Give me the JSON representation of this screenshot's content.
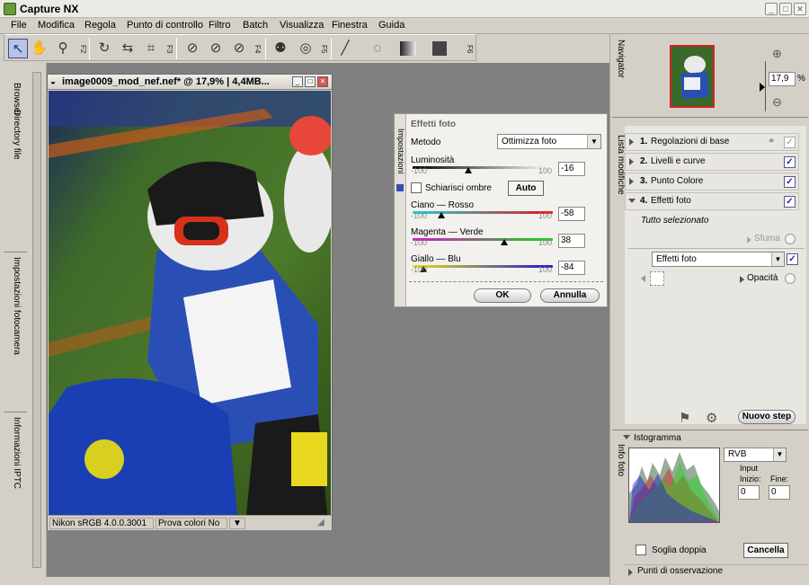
{
  "app": {
    "title": "Capture NX"
  },
  "window_controls": {
    "minimize": "_",
    "maximize": "□",
    "close": "✕"
  },
  "menu": [
    "File",
    "Modifica",
    "Regola",
    "Punto di controllo",
    "Filtro",
    "Batch",
    "Visualizza",
    "Finestra",
    "Guida"
  ],
  "toolbar": {
    "fkeys": [
      "F2",
      "F3",
      "F4",
      "F5",
      "F6"
    ],
    "icons": [
      "arrow-select-icon",
      "hand-icon",
      "zoom-icon",
      "rotate-icon",
      "straighten-icon",
      "crop-icon",
      "black-point-icon",
      "neutral-point-icon",
      "white-point-icon",
      "red-eye-icon",
      "selection-control-point-icon",
      "brush-icon",
      "lasso-icon",
      "gradient-icon",
      "fill-icon"
    ]
  },
  "left_tabs": [
    "Browser",
    "Directory file",
    "Impostazioni fotocamera",
    "Informazioni IPTC"
  ],
  "image_window": {
    "title": "image0009_mod_nef.nef* @ 17,9% | 4,4MB...",
    "status_profile": "Nikon sRGB 4.0.0.3001",
    "status_proof": "Prova colori No"
  },
  "dialog": {
    "title": "Effetti foto",
    "side_label": "Impostazioni",
    "method_label": "Metodo",
    "method_value": "Ottimizza foto",
    "luminosity_label": "Luminosità",
    "luminosity_min": "-100",
    "luminosity_max": "100",
    "luminosity_value": "-16",
    "shadow_label": "Schiarisci ombre",
    "auto_label": "Auto",
    "cyan_red_label": "Ciano — Rosso",
    "cyan_red_min": "-100",
    "cyan_red_max": "100",
    "cyan_red_value": "-58",
    "magenta_green_label": "Magenta — Verde",
    "magenta_green_min": "-100",
    "magenta_green_max": "100",
    "magenta_green_value": "38",
    "yellow_blue_label": "Giallo — Blu",
    "yellow_blue_min": "-100",
    "yellow_blue_max": "100",
    "yellow_blue_value": "-84",
    "ok_label": "OK",
    "cancel_label": "Annulla"
  },
  "navigator": {
    "label": "Navigator",
    "zoom_value": "17,9",
    "zoom_unit": "%"
  },
  "edit_list": {
    "label": "Lista modifiche",
    "steps": [
      {
        "num": "1.",
        "name": "Regolazioni di base",
        "checked": true
      },
      {
        "num": "2.",
        "name": "Livelli e curve",
        "checked": true
      },
      {
        "num": "3.",
        "name": "Punto Colore",
        "checked": true
      },
      {
        "num": "4.",
        "name": "Effetti foto",
        "checked": true
      }
    ],
    "selection_text": "Tutto selezionato",
    "feather_label": "Sfuma",
    "effect_dropdown": "Effetti foto",
    "opacity_label": "Opacità",
    "new_step_label": "Nuovo step"
  },
  "photo_info": {
    "label": "Info foto",
    "histogram_label": "Istogramma",
    "channel_value": "RVB",
    "input_label": "Input",
    "start_label": "Inizio:",
    "end_label": "Fine:",
    "start_value": "0",
    "end_value": "0",
    "double_threshold_label": "Soglia doppia",
    "cancel_label": "Cancella",
    "watch_points_label": "Punti di osservazione"
  },
  "colors": {
    "accent": "#1a2aa8",
    "canvas_gray": "#808080",
    "panel": "#d4d0c8"
  }
}
